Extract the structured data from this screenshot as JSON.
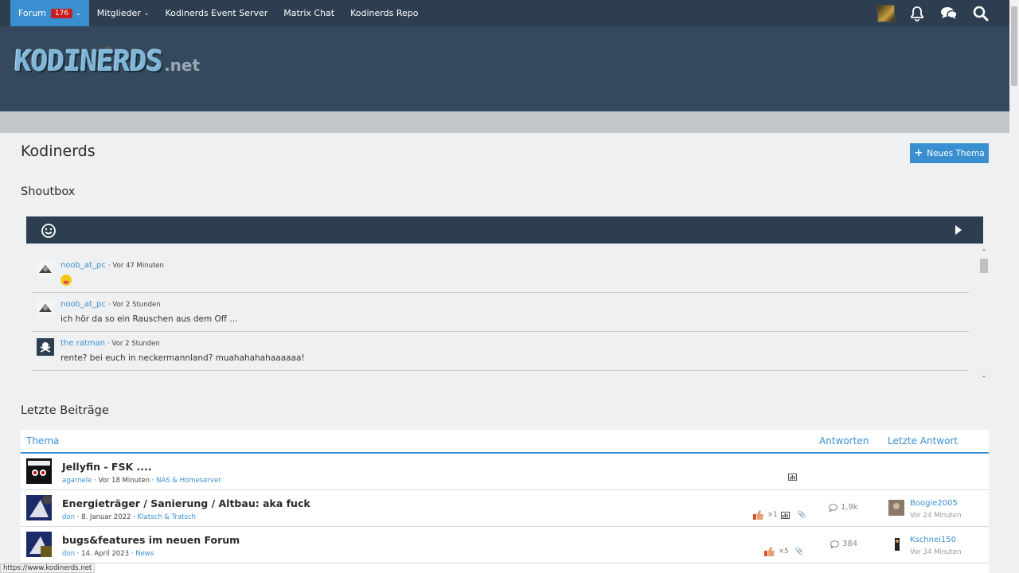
{
  "nav": {
    "forum_label": "Forum",
    "forum_badge": "176",
    "members_label": "Mitglieder",
    "event_server_label": "Kodinerds Event Server",
    "matrix_label": "Matrix Chat",
    "repo_label": "Kodinerds Repo"
  },
  "logo": {
    "main": "KODINERDS",
    "suffix": ".net"
  },
  "page": {
    "title": "Kodinerds",
    "new_topic_label": "Neues Thema"
  },
  "shoutbox": {
    "title": "Shoutbox",
    "messages": [
      {
        "user": "noob_at_pc",
        "time": "· Vor 47 Minuten",
        "text": ""
      },
      {
        "user": "noob_at_pc",
        "time": "· Vor 2 Stunden",
        "text": "ich hör da so ein Rauschen aus dem Off ..."
      },
      {
        "user": "the ratman",
        "time": "· Vor 2 Stunden",
        "text": "rente? bei euch in neckermannland? muahahahahaaaaaa!"
      }
    ]
  },
  "recent": {
    "title": "Letzte Beiträge",
    "col_topic": "Thema",
    "col_replies": "Antworten",
    "col_last": "Letzte Antwort",
    "posts": [
      {
        "title": "Jellyfin - FSK ....",
        "author": "agarnele",
        "date": "Vor 18 Minuten",
        "board": "NAS & Homeserver",
        "likes": "",
        "replies": "",
        "last_user": "",
        "last_time": ""
      },
      {
        "title": "Energieträger / Sanierung / Altbau: aka fuck",
        "author": "don",
        "date": "8. Januar 2022",
        "board": "Klatsch & Tratsch",
        "likes": "×1",
        "replies": "1,9k",
        "last_user": "Boogie2005",
        "last_time": "Vor 24 Minuten"
      },
      {
        "title": "bugs&features im neuen Forum",
        "author": "don",
        "date": "14. April 2023",
        "board": "News",
        "likes": "×5",
        "replies": "384",
        "last_user": "Kschnei150",
        "last_time": "Vor 34 Minuten"
      }
    ]
  },
  "status_url": "https://www.kodinerds.net",
  "colors": {
    "nav_bg": "#2c3e50",
    "accent": "#3a8fd0",
    "badge": "#c81e1e",
    "header_bg": "#34495e"
  }
}
